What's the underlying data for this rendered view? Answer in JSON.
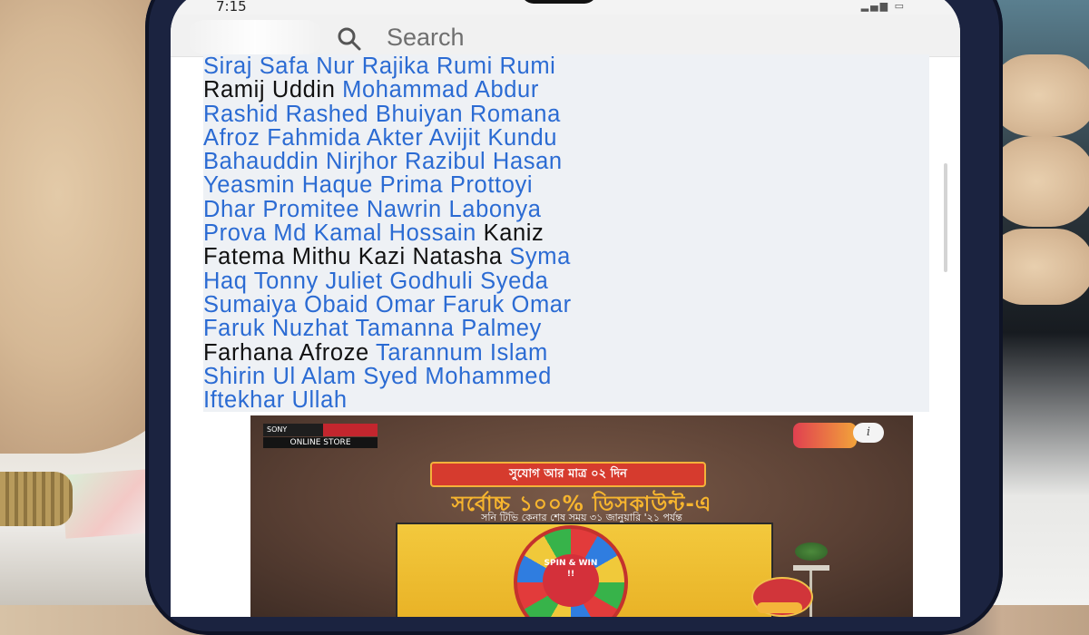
{
  "status_bar": {
    "time": "7:15"
  },
  "search": {
    "placeholder": "Search"
  },
  "article": {
    "lines": [
      [
        {
          "text": "Siraj Safa Nur Rajika Rumi Rumi",
          "link": true
        }
      ],
      [
        {
          "text": "Ramij Uddin ",
          "link": false
        },
        {
          "text": "Mohammad Abdur",
          "link": true
        }
      ],
      [
        {
          "text": "Rashid Rashed Bhuiyan Romana",
          "link": true
        }
      ],
      [
        {
          "text": "Afroz Fahmida Akter Avijit Kundu",
          "link": true
        }
      ],
      [
        {
          "text": "Bahauddin Nirjhor Razibul Hasan",
          "link": true
        }
      ],
      [
        {
          "text": "Yeasmin Haque Prima Prottoyi",
          "link": true
        }
      ],
      [
        {
          "text": "Dhar Promitee Nawrin Labonya",
          "link": true
        }
      ],
      [
        {
          "text": "Prova Md Kamal Hossain ",
          "link": true
        },
        {
          "text": "Kaniz",
          "link": false
        }
      ],
      [
        {
          "text": "Fatema Mithu Kazi Natasha ",
          "link": false
        },
        {
          "text": "Syma",
          "link": true
        }
      ],
      [
        {
          "text": "Haq Tonny Juliet Godhuli Syeda",
          "link": true
        }
      ],
      [
        {
          "text": "Sumaiya Obaid Omar Faruk Omar",
          "link": true
        }
      ],
      [
        {
          "text": "Faruk Nuzhat Tamanna Palmey",
          "link": true
        }
      ],
      [
        {
          "text": "Farhana Afroze ",
          "link": false
        },
        {
          "text": "Tarannum Islam",
          "link": true
        }
      ],
      [
        {
          "text": "Shirin Ul Alam Syed Mohammed",
          "link": true
        }
      ],
      [
        {
          "text": "Iftekhar Ullah",
          "link": true
        }
      ]
    ]
  },
  "ad": {
    "brand": "SONY",
    "brand_sub": "ONLINE STORE",
    "info_label": "i",
    "pill": "সুযোগ আর মাত্র ০২ দিন",
    "headline": "সর্বোচ্চ ১০০% ডিসকাউন্ট-এ",
    "subline": "সনি টিভি কেনার শেষ সময় ৩১ জানুয়ারি '২১ পর্যন্ত",
    "wheel_label": "SPIN & WIN !!",
    "colors": {
      "pill": "#d63b2e",
      "headline": "#f7b52e",
      "board": "#f3c93d"
    }
  },
  "colors": {
    "link": "#2b6bd3",
    "text": "#111111"
  }
}
